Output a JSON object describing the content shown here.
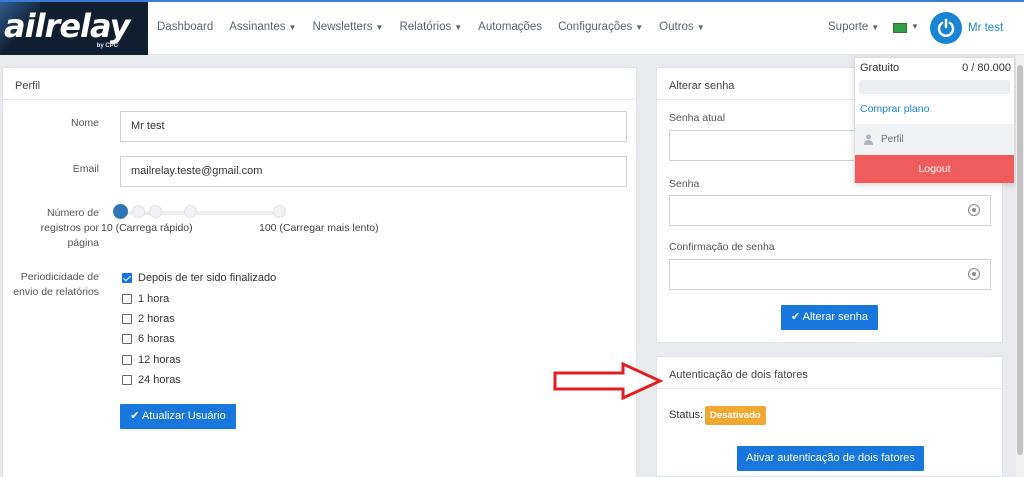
{
  "brand": {
    "name": "ailrelay",
    "byline": "by CPC"
  },
  "nav": {
    "items": [
      {
        "label": "Dashboard",
        "dropdown": false
      },
      {
        "label": "Assinantes",
        "dropdown": true
      },
      {
        "label": "Newsletters",
        "dropdown": true
      },
      {
        "label": "Relatórios",
        "dropdown": true
      },
      {
        "label": "Automações",
        "dropdown": false
      },
      {
        "label": "Configurações",
        "dropdown": true
      },
      {
        "label": "Outros",
        "dropdown": true
      }
    ],
    "support": "Suporte",
    "user": "Mr test"
  },
  "user_menu": {
    "plan": "Gratuito",
    "quota": "0 / 80.000",
    "quota_fraction": 0,
    "buy_plan": "Comprar plano",
    "profile": "Perfil",
    "logout": "Logout"
  },
  "profile": {
    "title": "Perfil",
    "name_label": "Nome",
    "name_value": "Mr test",
    "email_label": "Email",
    "email_value": "mailrelay.teste@gmail.com",
    "records_label": "Número de registros por página",
    "slider_min": "10 (Carrega rápido)",
    "slider_max": "100 (Carregar mais lento)",
    "slider_value": 10,
    "report_label": "Periodicidade de envio de relatórios",
    "options": [
      {
        "label": "Depois de ter sido finalizado",
        "checked": true
      },
      {
        "label": "1 hora",
        "checked": false
      },
      {
        "label": "2 horas",
        "checked": false
      },
      {
        "label": "6 horas",
        "checked": false
      },
      {
        "label": "12 horas",
        "checked": false
      },
      {
        "label": "24 horas",
        "checked": false
      }
    ],
    "submit": "Atualizar Usuário"
  },
  "password": {
    "title": "Alterar senha",
    "current_label": "Senha atual",
    "new_label": "Senha",
    "confirm_label": "Confirmação de senha",
    "submit": "Alterar senha"
  },
  "twofa": {
    "title": "Autenticação de dois fatores",
    "status_label": "Status:",
    "status_value": "Desativado",
    "activate": "Ativar autenticação de dois fatores"
  },
  "colors": {
    "primary": "#1777dd",
    "logout": "#f05b5b",
    "badge": "#f0a830",
    "arrow": "#e02020"
  }
}
